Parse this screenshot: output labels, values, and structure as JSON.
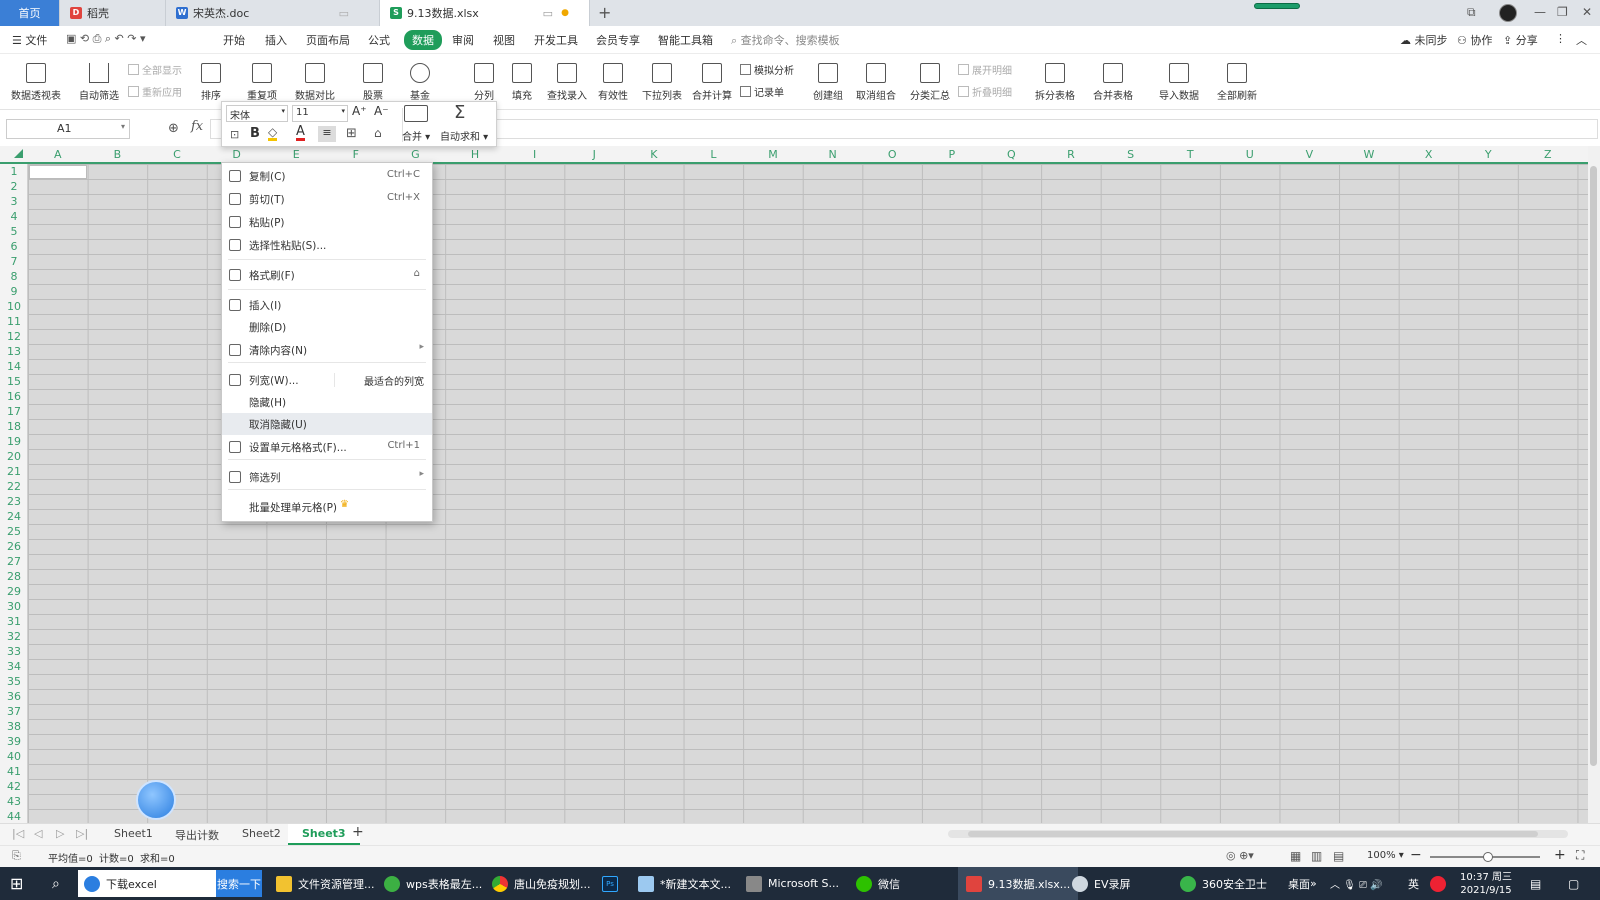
{
  "tabs": [
    {
      "label": "首页"
    },
    {
      "label": "稻壳"
    },
    {
      "label": "宋英杰.doc"
    },
    {
      "label": "9.13数据.xlsx"
    }
  ],
  "menu": {
    "file": "文件",
    "items": [
      "开始",
      "插入",
      "页面布局",
      "公式",
      "数据",
      "审阅",
      "视图",
      "开发工具",
      "会员专享",
      "智能工具箱"
    ],
    "search_placeholder": "查找命令、搜索模板",
    "sync": "未同步",
    "collab": "协作",
    "share": "分享"
  },
  "ribbon": {
    "pivot": "数据透视表",
    "autofilter": "自动筛选",
    "show_all": "全部显示",
    "reapply": "重新应用",
    "sort": "排序",
    "duplicates": "重复项",
    "compare": "数据对比",
    "stock": "股票",
    "fund": "基金",
    "split": "分列",
    "fill": "填充",
    "lookup": "查找录入",
    "validity": "有效性",
    "dropdown": "下拉列表",
    "consolidate": "合并计算",
    "whatif": "模拟分析",
    "record": "记录单",
    "group": "创建组",
    "ungroup": "取消组合",
    "subtotal": "分类汇总",
    "expand": "展开明细",
    "collapse": "折叠明细",
    "split_table": "拆分表格",
    "merge_table": "合并表格",
    "import": "导入数据",
    "refresh_all": "全部刷新"
  },
  "formula": {
    "cell_ref": "A1",
    "fx": "fx"
  },
  "minitoolbar": {
    "font": "宋体",
    "size": "11",
    "merge": "合并",
    "autosum": "自动求和",
    "grow": "A⁺",
    "shrink": "A⁻",
    "bold": "B",
    "fontcolor": "A"
  },
  "columns": [
    "A",
    "B",
    "C",
    "D",
    "E",
    "F",
    "G",
    "H",
    "I",
    "J",
    "K",
    "L",
    "M",
    "N",
    "O",
    "P",
    "Q",
    "R",
    "S",
    "T",
    "U",
    "V",
    "W",
    "X",
    "Y",
    "Z"
  ],
  "rows": [
    "1",
    "2",
    "3",
    "4",
    "5",
    "6",
    "7",
    "8",
    "9",
    "10",
    "11",
    "12",
    "13",
    "14",
    "15",
    "16",
    "17",
    "18",
    "19",
    "20",
    "21",
    "22",
    "23",
    "24",
    "25",
    "26",
    "27",
    "28",
    "29",
    "30",
    "31",
    "32",
    "33",
    "34",
    "35",
    "36",
    "37",
    "38",
    "39",
    "40",
    "41",
    "42",
    "43",
    "44"
  ],
  "context_menu": [
    {
      "label": "复制(C)",
      "shortcut": "Ctrl+C"
    },
    {
      "label": "剪切(T)",
      "shortcut": "Ctrl+X"
    },
    {
      "label": "粘贴(P)",
      "shortcut": ""
    },
    {
      "label": "选择性粘贴(S)...",
      "shortcut": ""
    },
    {
      "label": "格式刷(F)",
      "shortcut": ""
    },
    {
      "label": "插入(I)",
      "shortcut": ""
    },
    {
      "label": "删除(D)",
      "shortcut": ""
    },
    {
      "label": "清除内容(N)",
      "shortcut": ""
    },
    {
      "label": "列宽(W)...",
      "shortcut": "最适合的列宽"
    },
    {
      "label": "隐藏(H)",
      "shortcut": ""
    },
    {
      "label": "取消隐藏(U)",
      "shortcut": ""
    },
    {
      "label": "设置单元格格式(F)...",
      "shortcut": "Ctrl+1"
    },
    {
      "label": "筛选列",
      "shortcut": ""
    },
    {
      "label": "批量处理单元格(P)",
      "shortcut": ""
    }
  ],
  "sheets": [
    "Sheet1",
    "导出计数",
    "Sheet2",
    "Sheet3"
  ],
  "status": {
    "avg": "平均值=0",
    "count": "计数=0",
    "sum": "求和=0",
    "zoom": "100%"
  },
  "taskbar": [
    {
      "label": "下载excel"
    },
    {
      "label": "搜索一下"
    },
    {
      "label": "文件资源管理..."
    },
    {
      "label": "wps表格最左..."
    },
    {
      "label": "唐山免疫规划..."
    },
    {
      "label": "*新建文本文..."
    },
    {
      "label": "Microsoft S..."
    },
    {
      "label": "微信"
    },
    {
      "label": "9.13数据.xlsx..."
    },
    {
      "label": "EV录屏"
    },
    {
      "label": "360安全卫士"
    },
    {
      "label": "桌面"
    }
  ],
  "clock": {
    "time": "10:37 周三",
    "date": "2021/9/15"
  },
  "tray": {
    "lang": "英"
  },
  "colors": {
    "accent": "#1f9d5a",
    "header_text": "#3a9e6e",
    "taskbar": "#1f2b3a"
  }
}
